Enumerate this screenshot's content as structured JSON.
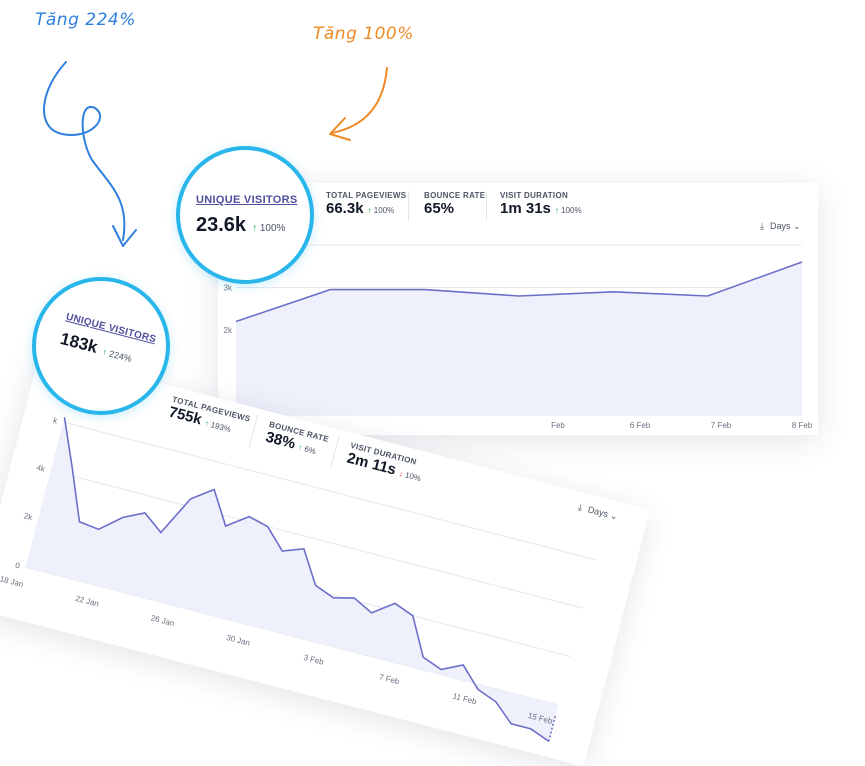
{
  "annotations": {
    "left": "Tăng 224%",
    "right": "Tăng 100%"
  },
  "colors": {
    "annotation_left": "#2f7fdf",
    "annotation_right": "#ef8a25",
    "highlight_ring": "#29b6ea",
    "series_line": "#6b6fc9",
    "series_fill": "#eef0fb",
    "increase": "#16a34a",
    "decrease": "#ef4444"
  },
  "card_back": {
    "stats": [
      {
        "label": "UNIQUE VISITORS",
        "value": "23.6k",
        "change": "100%",
        "direction": "up"
      },
      {
        "label": "TOTAL PAGEVIEWS",
        "value": "66.3k",
        "change": "100%",
        "direction": "up"
      },
      {
        "label": "BOUNCE RATE",
        "value": "65%",
        "change": "",
        "direction": ""
      },
      {
        "label": "VISIT DURATION",
        "value": "1m 31s",
        "change": "100%",
        "direction": "up"
      }
    ],
    "interval_label": "Days",
    "download_icon": "download-icon",
    "dropdown_icon": "chevron-down-icon"
  },
  "card_front": {
    "stats": [
      {
        "label": "UNIQUE VISITORS",
        "value": "183k",
        "change": "224%",
        "direction": "up"
      },
      {
        "label": "TOTAL PAGEVIEWS",
        "value": "755k",
        "change": "193%",
        "direction": "up"
      },
      {
        "label": "BOUNCE RATE",
        "value": "38%",
        "change": "6%",
        "direction": "up"
      },
      {
        "label": "VISIT DURATION",
        "value": "2m 11s",
        "change": "10%",
        "direction": "down"
      }
    ],
    "interval_label": "Days",
    "download_icon": "download-icon",
    "dropdown_icon": "chevron-down-icon"
  },
  "chart_data": [
    {
      "type": "area",
      "x": [
        "",
        "",
        "",
        "",
        "6 Feb",
        "7 Feb",
        "8 Feb"
      ],
      "values": [
        2200,
        2950,
        2950,
        2800,
        2900,
        2800,
        3600
      ],
      "x_tick_labels": [
        "Feb",
        "6 Feb",
        "7 Feb",
        "8 Feb"
      ],
      "y_tick_labels": [
        "3k",
        "2k"
      ],
      "ylim": [
        0,
        4000
      ],
      "grid": true,
      "title": "",
      "xlabel": "",
      "ylabel": ""
    },
    {
      "type": "area",
      "x_tick_labels": [
        "18 Jan",
        "22 Jan",
        "26 Jan",
        "30 Jan",
        "3 Feb",
        "7 Feb",
        "11 Feb",
        "15 Feb"
      ],
      "y_tick_labels": [
        "k",
        "4k",
        "2k",
        "0"
      ],
      "values": [
        6200,
        4300,
        2300,
        2200,
        2900,
        3300,
        2700,
        4300,
        4900,
        3600,
        4200,
        4000,
        3200,
        3500,
        2200,
        1900,
        2100,
        1700,
        2300,
        2000,
        500,
        200,
        600,
        -200,
        -500,
        -1200,
        -1200,
        -1500
      ],
      "ylim": [
        0,
        6000
      ],
      "grid": true,
      "title": "",
      "xlabel": "",
      "ylabel": ""
    }
  ]
}
